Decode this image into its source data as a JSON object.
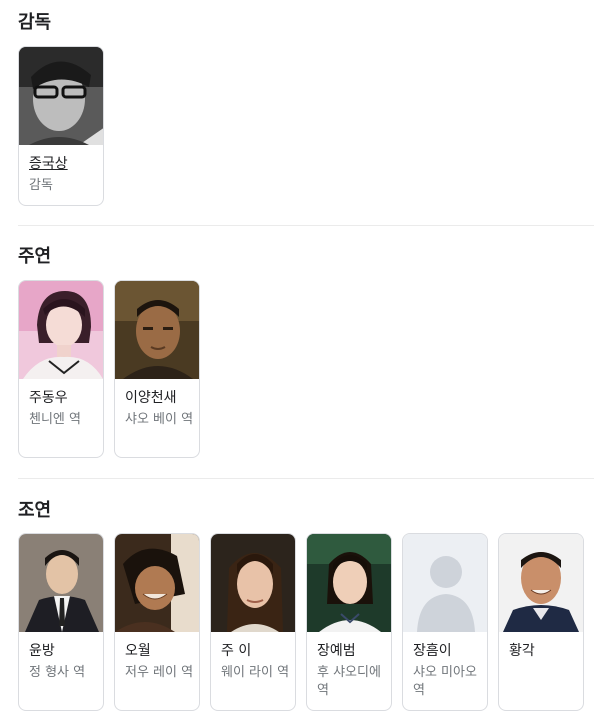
{
  "sections": [
    {
      "title": "감독",
      "people": [
        {
          "name": "증국상",
          "role": "감독",
          "photo": "photo-director-bw"
        }
      ]
    },
    {
      "title": "주연",
      "people": [
        {
          "name": "주동우",
          "role": "첸니엔 역",
          "photo": "photo-woman-pink"
        },
        {
          "name": "이양천새",
          "role": "샤오 베이 역",
          "photo": "photo-man-dark"
        }
      ]
    },
    {
      "title": "조연",
      "people": [
        {
          "name": "윤방",
          "role": "정 형사 역",
          "photo": "photo-man-suit"
        },
        {
          "name": "오월",
          "role": "저우 레이 역",
          "photo": "photo-woman-laughing"
        },
        {
          "name": "주 이",
          "role": "웨이 라이 역",
          "photo": "photo-girl-longhair"
        },
        {
          "name": "장예범",
          "role": "후 샤오디에 역",
          "photo": "photo-girl-uniform"
        },
        {
          "name": "장흠이",
          "role": "샤오 미아오 역",
          "photo": "placeholder-person-icon"
        },
        {
          "name": "황각",
          "role": "",
          "photo": "photo-man-smiling"
        }
      ]
    }
  ]
}
